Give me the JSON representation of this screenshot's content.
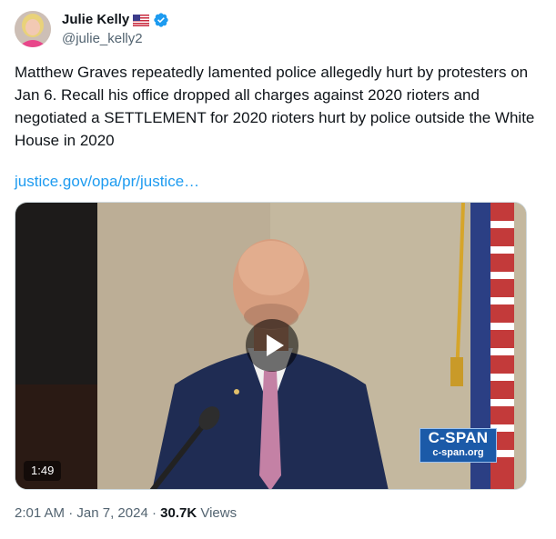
{
  "author": {
    "display_name": "Julie Kelly",
    "handle": "@julie_kelly2",
    "flag_icon": "us-flag-icon",
    "verified_icon": "verified-badge-icon",
    "verified_color": "#1d9bf0"
  },
  "tweet": {
    "text": "Matthew Graves repeatedly lamented police allegedly hurt by protesters on Jan 6. Recall his office dropped all charges against 2020 rioters and negotiated a SETTLEMENT for 2020 rioters hurt by police outside the White House in 2020",
    "link_text": "justice.gov/opa/pr/justice…",
    "link_color": "#1d9bf0"
  },
  "media": {
    "duration": "1:49",
    "play_icon": "play-icon",
    "watermark": {
      "brand": "C-SPAN",
      "url": "c-span.org",
      "color": "#1b5aa8"
    }
  },
  "meta": {
    "time": "2:01 AM",
    "separator": "·",
    "date": "Jan 7, 2024",
    "views_count": "30.7K",
    "views_label": "Views"
  }
}
